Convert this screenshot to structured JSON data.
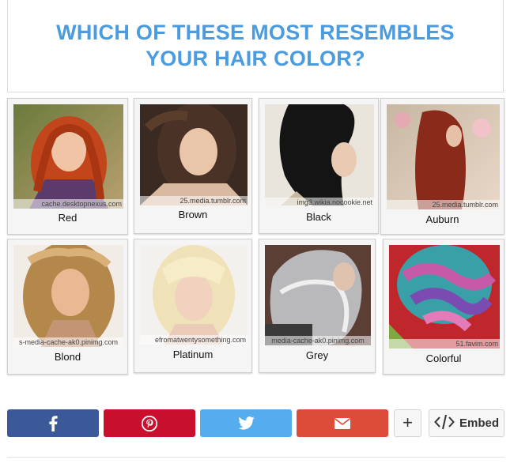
{
  "quiz": {
    "question": "WHICH OF THESE MOST RESEMBLES YOUR HAIR COLOR?"
  },
  "options": [
    {
      "label": "Red",
      "credit": "cache.desktopnexus.com"
    },
    {
      "label": "Brown",
      "credit": "25.media.tumblr.com"
    },
    {
      "label": "Black",
      "credit": "img3.wikia.nocookie.net"
    },
    {
      "label": "Auburn",
      "credit": "25.media.tumblr.com"
    },
    {
      "label": "Blond",
      "credit": "s-media-cache-ak0.pinimg.com"
    },
    {
      "label": "Platinum",
      "credit": "efromatwentysomething.com"
    },
    {
      "label": "Grey",
      "credit": "media-cache-ak0.pinimg.com"
    },
    {
      "label": "Colorful",
      "credit": "51.favim.com"
    }
  ],
  "share": {
    "facebook_icon": "facebook-icon",
    "pinterest_icon": "pinterest-icon",
    "twitter_icon": "twitter-icon",
    "email_icon": "email-icon",
    "more_label": "+",
    "embed_label": "Embed",
    "colors": {
      "facebook": "#3b5998",
      "pinterest": "#c8102e",
      "twitter": "#55acee",
      "email": "#dd4b39"
    }
  },
  "theme": {
    "title_color": "#4a9be0"
  }
}
